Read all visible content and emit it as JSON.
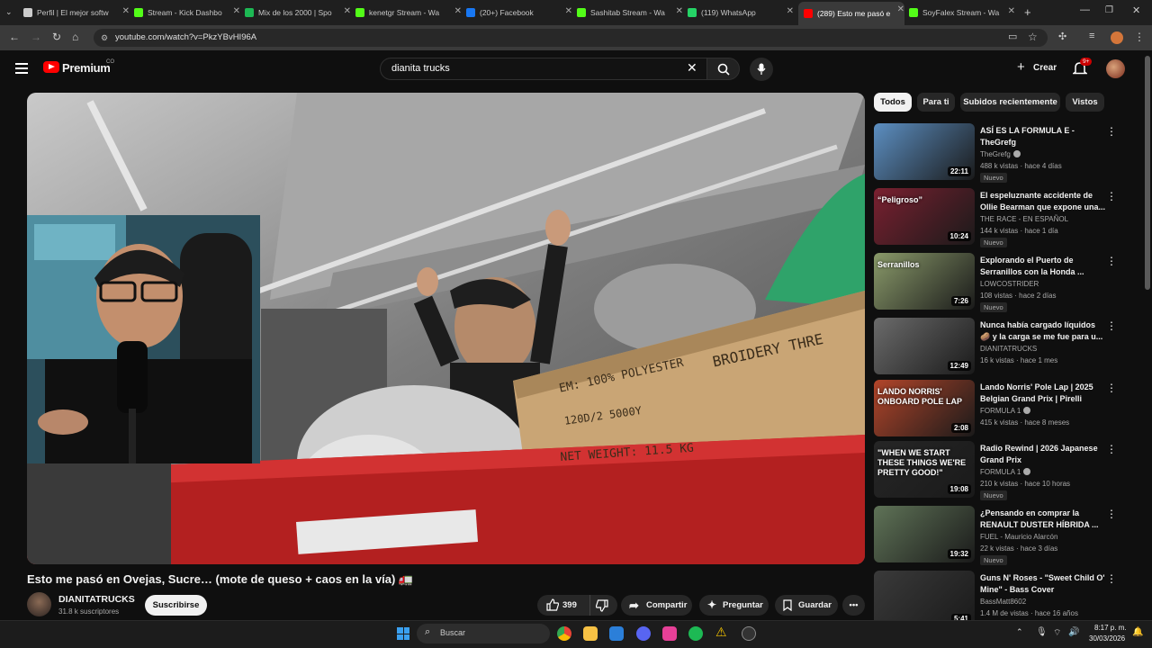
{
  "browser": {
    "tabs": [
      {
        "label": "Perfil | El mejor softw",
        "color": "#cccccc"
      },
      {
        "label": "Stream - Kick Dashbo",
        "color": "#53fc18"
      },
      {
        "label": "Mix de los 2000 | Spo",
        "color": "#1db954"
      },
      {
        "label": "kenetgr Stream - Wa",
        "color": "#53fc18"
      },
      {
        "label": "(20+) Facebook",
        "color": "#1877f2"
      },
      {
        "label": "Sashitab Stream - Wa",
        "color": "#53fc18"
      },
      {
        "label": "(119) WhatsApp",
        "color": "#25d366"
      },
      {
        "label": "(289) Esto me pasó e",
        "color": "#ff0000"
      },
      {
        "label": "SoyFalex Stream - Wa",
        "color": "#53fc18"
      }
    ],
    "url": "youtube.com/watch?v=PkzYBvHI96A"
  },
  "header": {
    "logo_text": "Premium",
    "country_code": "CO",
    "search_value": "dianita trucks",
    "create_label": "Crear",
    "notif_count": "9+"
  },
  "chips": [
    "Todos",
    "Para ti",
    "Subidos recientemente",
    "Vistos"
  ],
  "video": {
    "title": "Esto me pasó en Ovejas, Sucre… (mote de queso + caos en la vía) 🚛",
    "box_text_1": "EM: 100% POLYESTER",
    "box_text_2": "BROIDERY THRE",
    "box_text_3": "120D/2  5000Y",
    "box_text_4": "NET WEIGHT:   11.5   KG"
  },
  "channel": {
    "name": "DIANITATRUCKS",
    "subs": "31.8 k suscriptores",
    "subscribe_label": "Suscribirse"
  },
  "actions": {
    "likes": "399",
    "share": "Compartir",
    "ask": "Preguntar",
    "save": "Guardar"
  },
  "recs": [
    {
      "title": "ASÍ ES LA FORMULA E - TheGrefg",
      "channel": "TheGrefg",
      "verified": true,
      "meta": "488 k vistas · hace 4 días",
      "badge": "Nuevo",
      "dur": "22:11",
      "bg": "#5c8fc2"
    },
    {
      "title": "El espeluznante accidente de Ollie Bearman que expone una...",
      "channel": "THE RACE - EN ESPAÑOL",
      "verified": false,
      "meta": "144 k vistas · hace 1 día",
      "badge": "Nuevo",
      "dur": "10:24",
      "bg": "#7a2030",
      "overlay": "“Peligroso”"
    },
    {
      "title": "Explorando el Puerto de Serranillos con la Honda ...",
      "channel": "LOWCOSTRIDER",
      "verified": false,
      "meta": "108 vistas · hace 2 días",
      "badge": "Nuevo",
      "dur": "7:26",
      "bg": "#8a9a6a",
      "overlay": "Serranillos"
    },
    {
      "title": "Nunca había cargado líquidos 🥔 y la carga se me fue para u...",
      "channel": "DIANITATRUCKS",
      "verified": false,
      "meta": "16 k vistas · hace 1 mes",
      "badge": "",
      "dur": "12:49",
      "bg": "#6b6b6b"
    },
    {
      "title": "Lando Norris' Pole Lap | 2025 Belgian Grand Prix | Pirelli",
      "channel": "FORMULA 1",
      "verified": true,
      "meta": "415 k vistas · hace 8 meses",
      "badge": "",
      "dur": "2:08",
      "bg": "#b2452a",
      "overlay": "LANDO NORRIS' ONBOARD POLE LAP"
    },
    {
      "title": "Radio Rewind | 2026 Japanese Grand Prix",
      "channel": "FORMULA 1",
      "verified": true,
      "meta": "210 k vistas · hace 10 horas",
      "badge": "Nuevo",
      "dur": "19:08",
      "bg": "#262626",
      "overlay": "\"WHEN WE START THESE THINGS WE'RE PRETTY GOOD!\""
    },
    {
      "title": "¿Pensando en comprar la RENAULT DUSTER HÍBRIDA ...",
      "channel": "FUEL - Mauricio Alarcón",
      "verified": false,
      "meta": "22 k vistas · hace 3 días",
      "badge": "Nuevo",
      "dur": "19:32",
      "bg": "#5f7357"
    },
    {
      "title": "Guns N' Roses - \"Sweet Child O' Mine\" - Bass Cover",
      "channel": "BassMatt8602",
      "verified": false,
      "meta": "1.4 M de vistas · hace 16 años",
      "badge": "",
      "dur": "5:41",
      "bg": "#3a3a3a"
    }
  ],
  "taskbar": {
    "search_label": "Buscar",
    "time": "8:17 p. m.",
    "date": "30/03/2026"
  },
  "icons": [
    "menu-icon",
    "search-icon",
    "mic-icon",
    "bell-icon",
    "plus-icon",
    "like-icon",
    "dislike-icon",
    "share-icon",
    "sparkle-icon",
    "bookmark-icon"
  ]
}
